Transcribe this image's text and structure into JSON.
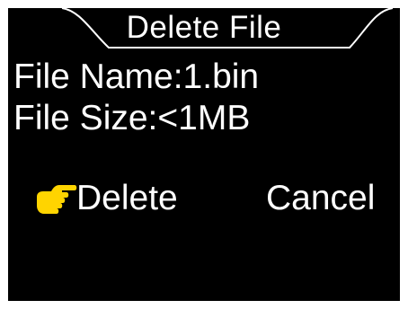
{
  "dialog": {
    "title": "Delete File",
    "file_name_label": "File Name:1.bin",
    "file_size_label": "File Size:<1MB"
  },
  "actions": {
    "delete_label": "Delete",
    "cancel_label": "Cancel",
    "selected": "delete"
  },
  "icons": {
    "selection_pointer": "pointing-hand-icon"
  },
  "colors": {
    "background": "#000000",
    "text": "#ffffff",
    "pointer": "#ffd400",
    "frame": "#ffffff"
  }
}
